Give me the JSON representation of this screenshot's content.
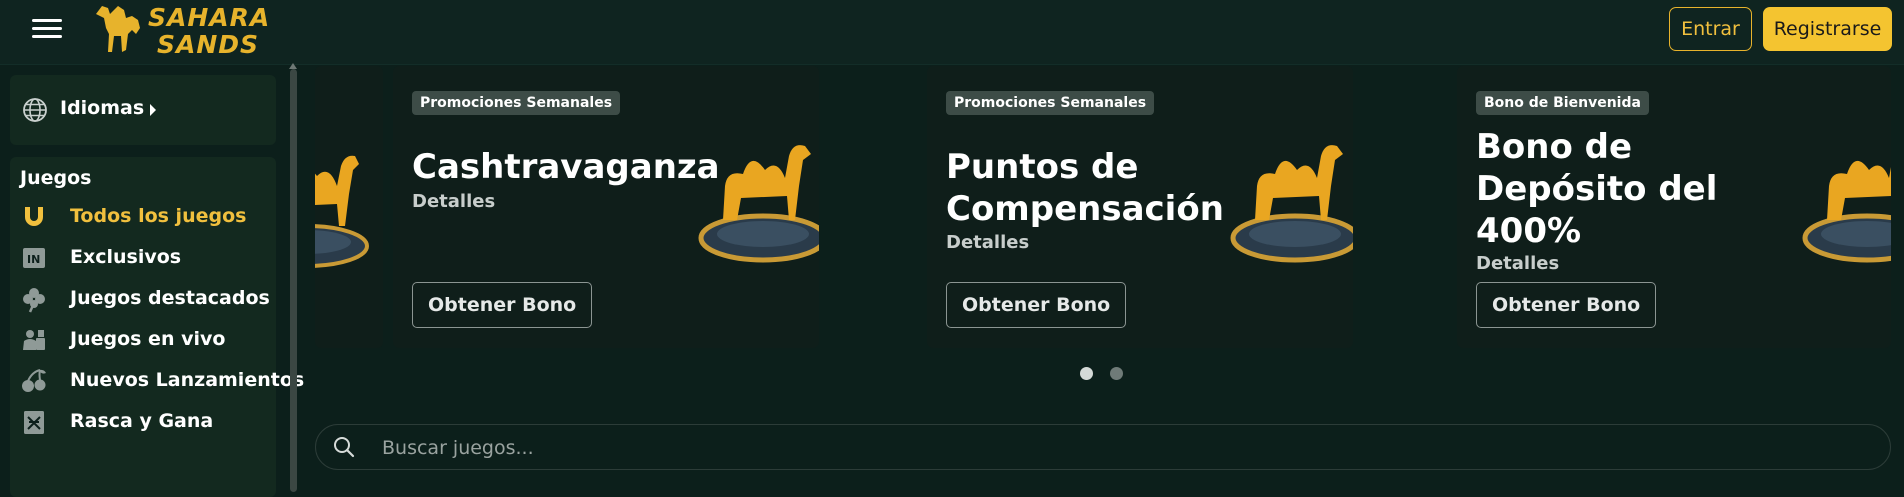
{
  "header": {
    "logo_line1": "SAHARA",
    "logo_line2": "SANDS",
    "login_label": "Entrar",
    "register_label": "Registrarse"
  },
  "sidebar": {
    "language_label": "Idiomas",
    "games_title": "Juegos",
    "items": [
      {
        "label": "Todos los juegos",
        "icon": "horseshoe-icon",
        "active": true
      },
      {
        "label": "Exclusivos",
        "icon": "exclusive-icon",
        "active": false
      },
      {
        "label": "Juegos destacados",
        "icon": "clover-icon",
        "active": false
      },
      {
        "label": "Juegos en vivo",
        "icon": "live-dealer-icon",
        "active": false
      },
      {
        "label": "Nuevos Lanzamientos",
        "icon": "cherries-icon",
        "active": false
      },
      {
        "label": "Rasca y Gana",
        "icon": "scratch-card-icon",
        "active": false
      }
    ]
  },
  "promotions": [
    {
      "badge": "Promociones Semanales",
      "title": "Cashtravaganza",
      "details": "Detalles",
      "button": "Obtener Bono"
    },
    {
      "badge": "Promociones Semanales",
      "title": "Puntos de Compensación",
      "details": "Detalles",
      "button": "Obtener Bono"
    },
    {
      "badge": "Bono de Bienvenida",
      "title": "Bono de Depósito del 400%",
      "details": "Detalles",
      "button": "Obtener Bono"
    }
  ],
  "carousel": {
    "active_index": 0,
    "page_count": 2
  },
  "search": {
    "placeholder": "Buscar juegos..."
  },
  "colors": {
    "background": "#0c1f1b",
    "accent": "#f4c430",
    "card": "#0f1e1a",
    "badge": "#3d4c47"
  }
}
